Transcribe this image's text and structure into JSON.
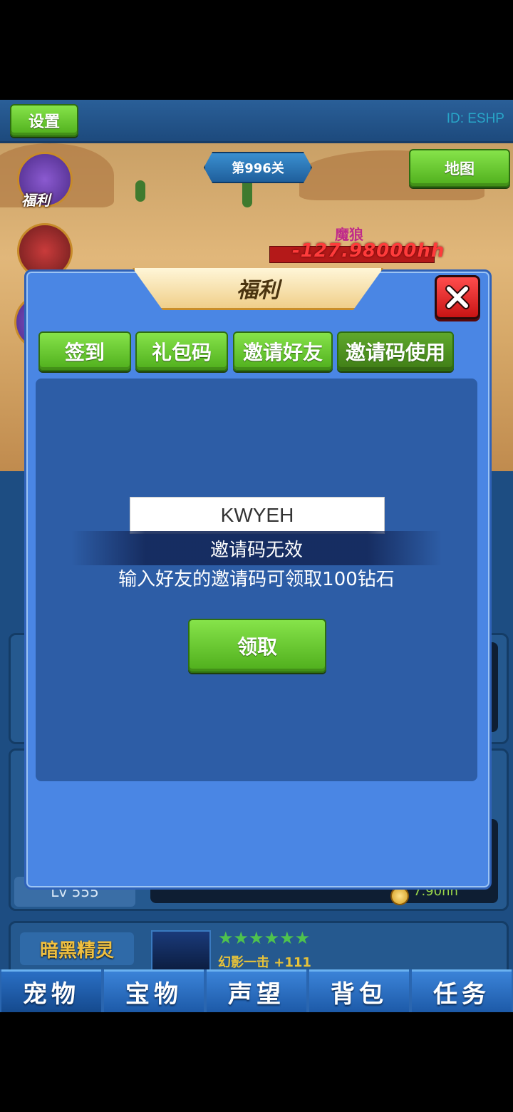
{
  "topbar": {
    "settings_label": "设置",
    "player_id": "ID: ESHP"
  },
  "scene": {
    "stage_label": "第996关",
    "map_label": "地图",
    "side_welfare_label": "福利",
    "enemy_name": "魔狼",
    "damage_text": "-127.98000hh"
  },
  "pets": {
    "level_label": "Lv 555",
    "coin_value": "7.90hh",
    "pet_name": "暗黑精灵",
    "stars": "★★★★★★",
    "skill_text": "幻影一击   +111"
  },
  "bottom_nav": {
    "tabs": [
      "宠物",
      "宝物",
      "声望",
      "背包",
      "任务"
    ]
  },
  "modal": {
    "title": "福利",
    "tabs": [
      "签到",
      "礼包码",
      "邀请好友",
      "邀请码使用"
    ],
    "selected_tab": "邀请码使用",
    "input_value": "KWYEH",
    "toast": "邀请码无效",
    "hint": "输入好友的邀请码可领取100钻石",
    "claim_label": "领取"
  },
  "colors": {
    "accent_green": "#6ccc2e",
    "modal_blue": "#4a86e4",
    "close_red": "#e02020"
  }
}
